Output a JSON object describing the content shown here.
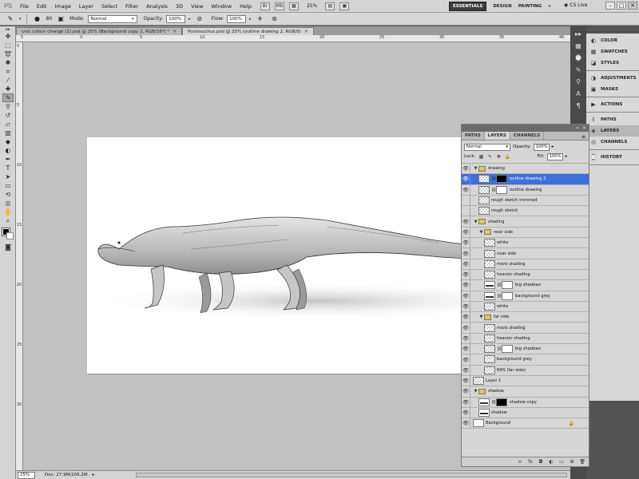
{
  "app": {
    "logo": "PS"
  },
  "menu": {
    "items": [
      "File",
      "Edit",
      "Image",
      "Layer",
      "Select",
      "Filter",
      "Analysis",
      "3D",
      "View",
      "Window",
      "Help"
    ],
    "zoom": "25%",
    "workspaces": {
      "active": "ESSENTIALS",
      "others": [
        "DESIGN",
        "PAINTING"
      ],
      "more": "»"
    },
    "cs_live": "CS Live"
  },
  "options": {
    "brush_size": "80",
    "mode_label": "Mode:",
    "mode_value": "Normal",
    "opacity_label": "Opacity:",
    "opacity_value": "100%",
    "flow_label": "Flow:",
    "flow_value": "100%"
  },
  "tabs": [
    {
      "label": "croc colour change (2).psd @ 25% (Background copy 2, RGB/16*) *",
      "active": false
    },
    {
      "label": "Postosuchus.psd @ 25% (outline drawing 2, RGB/8)",
      "active": true
    }
  ],
  "rulers": {
    "top": [
      "5",
      "0",
      "5",
      "10",
      "15",
      "20",
      "25",
      "30",
      "35",
      "40"
    ],
    "left": [
      "0",
      "5",
      "10",
      "15",
      "20",
      "25",
      "30"
    ]
  },
  "status": {
    "zoom": "25%",
    "doc": "Doc: 27.9M/206.2M"
  },
  "dock": {
    "group1": [
      {
        "icon": "color-icon",
        "label": "COLOR"
      },
      {
        "icon": "swatches-icon",
        "label": "SWATCHES"
      },
      {
        "icon": "styles-icon",
        "label": "STYLES"
      }
    ],
    "group2": [
      {
        "icon": "adjustments-icon",
        "label": "ADJUSTMENTS"
      },
      {
        "icon": "masks-icon",
        "label": "MASKS"
      }
    ],
    "group3": [
      {
        "icon": "actions-icon",
        "label": "ACTIONS"
      }
    ],
    "group4": [
      {
        "icon": "paths-icon",
        "label": "PATHS"
      },
      {
        "icon": "layers-icon",
        "label": "LAYERS"
      },
      {
        "icon": "channels-icon",
        "label": "CHANNELS"
      }
    ],
    "group5": [
      {
        "icon": "history-icon",
        "label": "HISTORY"
      }
    ]
  },
  "layers_panel": {
    "collapse": "«",
    "close": "✕",
    "tabs": [
      "PATHS",
      "LAYERS",
      "CHANNELS"
    ],
    "active_tab": "LAYERS",
    "blend_mode": "Normal",
    "opacity_label": "Opacity:",
    "opacity": "100%",
    "lock_label": "Lock:",
    "fill_label": "Fill:",
    "fill": "100%",
    "layers": [
      {
        "name": "drawing",
        "kind": "group",
        "level": 0,
        "visible": true
      },
      {
        "name": "outline drawing 2",
        "kind": "masked",
        "level": 1,
        "visible": true,
        "selected": true,
        "mask": "black"
      },
      {
        "name": "outline drawing",
        "kind": "masked",
        "level": 1,
        "visible": true,
        "mask": "white"
      },
      {
        "name": "rough sketch trimmed",
        "kind": "layer",
        "level": 1,
        "visible": false
      },
      {
        "name": "rough sketch",
        "kind": "layer",
        "level": 1,
        "visible": false
      },
      {
        "name": "shading",
        "kind": "group",
        "level": 0,
        "visible": true
      },
      {
        "name": "near side",
        "kind": "group",
        "level": 1,
        "visible": true
      },
      {
        "name": "white",
        "kind": "layer",
        "level": 2,
        "visible": true
      },
      {
        "name": "near side",
        "kind": "layer",
        "level": 2,
        "visible": true
      },
      {
        "name": "more shading",
        "kind": "layer",
        "level": 2,
        "visible": true
      },
      {
        "name": "heavier shading",
        "kind": "layer",
        "level": 2,
        "visible": true
      },
      {
        "name": "big shadows",
        "kind": "masked",
        "level": 2,
        "visible": true,
        "mask": "white",
        "content": true
      },
      {
        "name": "background grey",
        "kind": "masked",
        "level": 2,
        "visible": true,
        "mask": "white",
        "content": true
      },
      {
        "name": "white",
        "kind": "layer",
        "level": 2,
        "visible": true
      },
      {
        "name": "far side",
        "kind": "group",
        "level": 1,
        "visible": true
      },
      {
        "name": "more shading",
        "kind": "layer",
        "level": 2,
        "visible": true
      },
      {
        "name": "heavier shading",
        "kind": "layer",
        "level": 2,
        "visible": true
      },
      {
        "name": "big shadows",
        "kind": "masked",
        "level": 2,
        "visible": true,
        "mask": "white"
      },
      {
        "name": "background grey",
        "kind": "layer",
        "level": 2,
        "visible": true
      },
      {
        "name": "RHS (far side)",
        "kind": "layer",
        "level": 2,
        "visible": true
      },
      {
        "name": "Layer 1",
        "kind": "layer",
        "level": 0,
        "visible": true
      },
      {
        "name": "shadow",
        "kind": "group",
        "level": 0,
        "visible": true
      },
      {
        "name": "shadow copy",
        "kind": "masked",
        "level": 1,
        "visible": true,
        "mask": "black",
        "content": true
      },
      {
        "name": "shadow",
        "kind": "layer",
        "level": 1,
        "visible": true,
        "content": true
      },
      {
        "name": "Background",
        "kind": "background",
        "level": 0,
        "visible": true
      }
    ]
  }
}
